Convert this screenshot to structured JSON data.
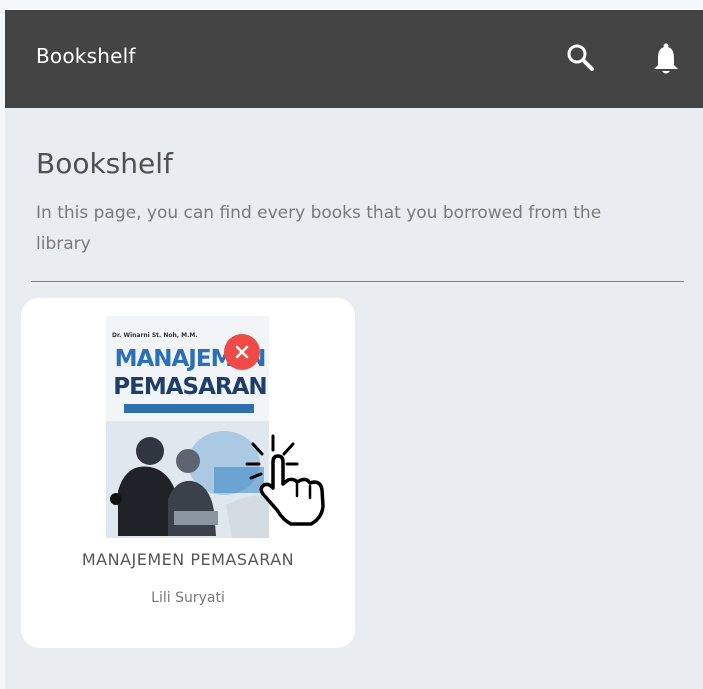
{
  "topbar": {
    "title": "Bookshelf",
    "icons": [
      "search-icon",
      "bell-icon"
    ],
    "bg_color": "#444444"
  },
  "page": {
    "heading": "Bookshelf",
    "description": "In this page, you can find every books that you borrowed from the library"
  },
  "books": [
    {
      "title": "MANAJEMEN PEMASARAN",
      "author": "Lili Suryati",
      "cover": {
        "author_line": "Dr. Winarni St. Noh, M.M.",
        "title_line1": "MANAJEMEN",
        "title_line2": "PEMASARAN"
      },
      "remove_icon": "close-icon",
      "remove_color": "#ef4a45"
    }
  ],
  "colors": {
    "background": "#e9ecf0",
    "card": "#ffffff",
    "accent": "#ef4a45"
  }
}
